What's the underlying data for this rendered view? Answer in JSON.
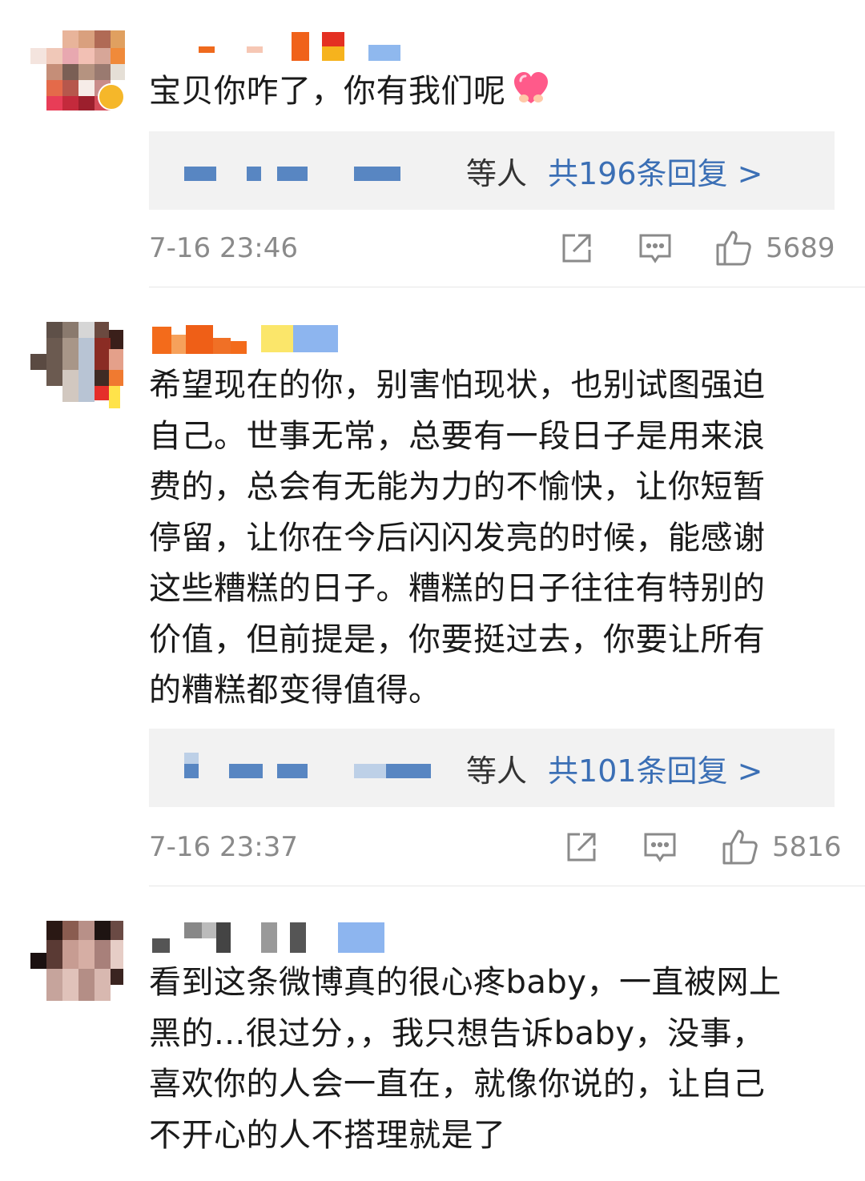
{
  "comments": [
    {
      "text": "宝贝你咋了，你有我们呢",
      "emoji_icon": "heart-emoji",
      "reply_suffix": "等人",
      "reply_count_text": "共196条回复 >",
      "time": "7-16 23:46",
      "likes": "5689"
    },
    {
      "text": "希望现在的你，别害怕现状，也别试图强迫\n自己。世事无常，总要有一段日子是用来浪\n费的，总会有无能为力的不愉快，让你短暂\n停留，让你在今后闪闪发亮的时候，能感谢\n这些糟糕的日子。糟糕的日子往往有特别的\n价值，但前提是，你要挺过去，你要让所有\n的糟糕都变得值得。",
      "reply_suffix": "等人",
      "reply_count_text": "共101条回复 >",
      "time": "7-16 23:37",
      "likes": "5816"
    },
    {
      "text": "看到这条微博真的很心疼baby，一直被网上\n黑的...很过分，，我只想告诉baby，没事，\n喜欢你的人会一直在，就像你说的，让自己\n不开心的人不搭理就是了"
    }
  ],
  "icons": {
    "share": "share-icon",
    "comment": "comment-icon",
    "like": "thumbs-up-icon"
  },
  "colors": {
    "link": "#3b6fb5",
    "meta": "#8a8a8a",
    "reply_bg": "#f2f2f2"
  }
}
